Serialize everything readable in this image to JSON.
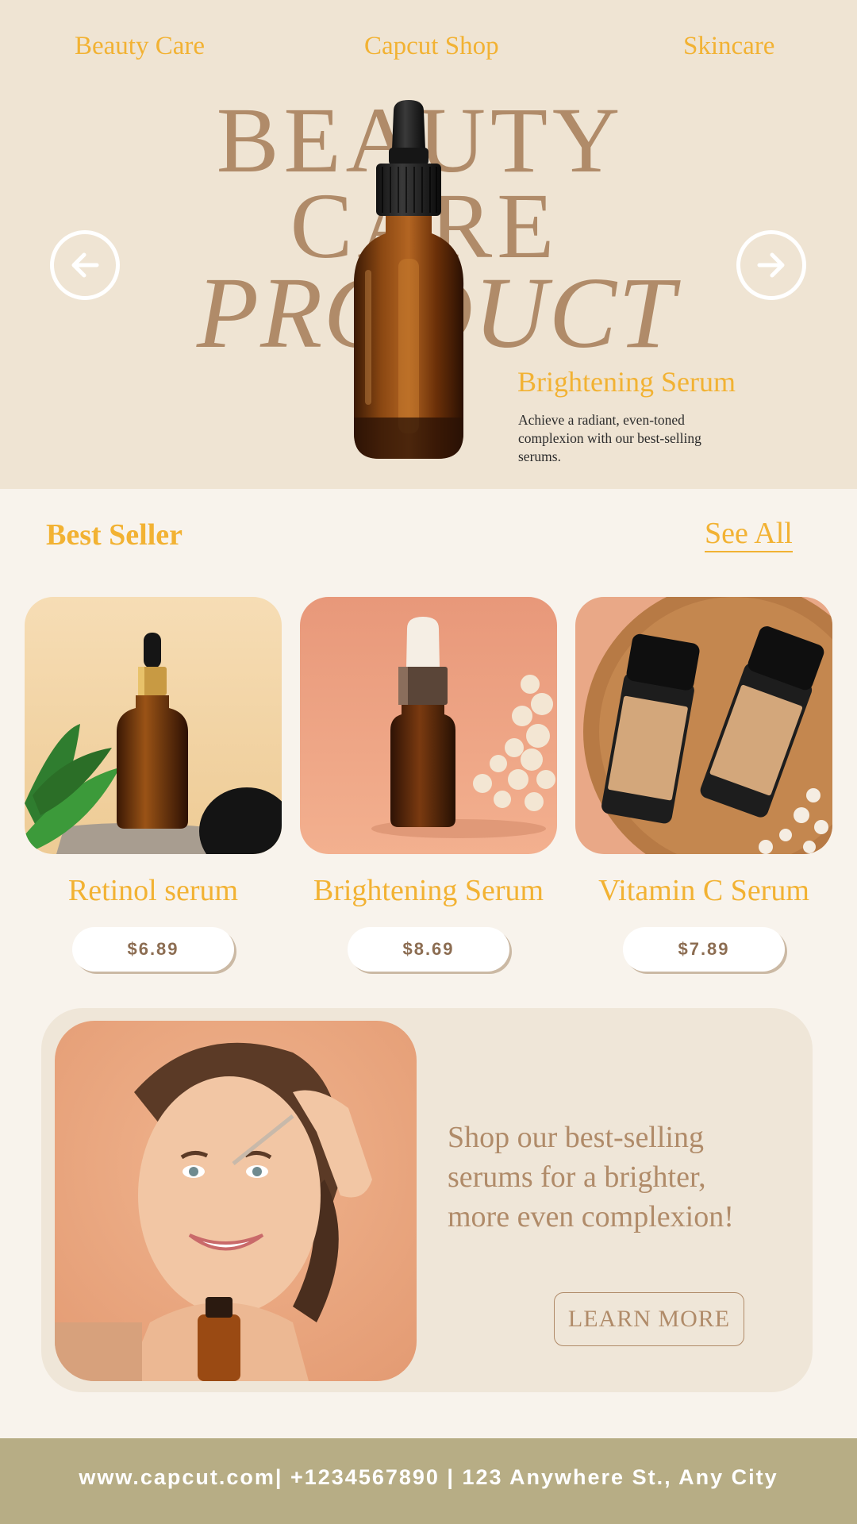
{
  "nav": {
    "items": [
      {
        "label": "Beauty Care"
      },
      {
        "label": "Capcut Shop"
      },
      {
        "label": "Skincare"
      }
    ]
  },
  "hero": {
    "headline": [
      "BEAUTY",
      "CARE",
      "PRODUCT"
    ],
    "product_title": "Brightening Serum",
    "product_description": "Achieve a radiant, even-toned complexion with our best-selling serums.",
    "prev_icon": "arrow-left-circle-icon",
    "next_icon": "arrow-right-circle-icon"
  },
  "best_seller": {
    "title": "Best Seller",
    "see_all": "See All",
    "products": [
      {
        "name": "Retinol serum",
        "price": "$6.89"
      },
      {
        "name": "Brightening Serum",
        "price": "$8.69"
      },
      {
        "name": "Vitamin C Serum",
        "price": "$7.89"
      }
    ]
  },
  "promo": {
    "text": "Shop our best-selling serums for a brighter, more even complexion!",
    "cta": "LEARN MORE"
  },
  "footer": {
    "contact": "www.capcut.com| +1234567890 | 123 Anywhere St., Any City"
  },
  "colors": {
    "accent": "#f2b233",
    "headline": "#b08b69",
    "hero_bg": "#efe4d3",
    "page_bg": "#f8f3ec",
    "footer_bg": "#b7ad85"
  }
}
